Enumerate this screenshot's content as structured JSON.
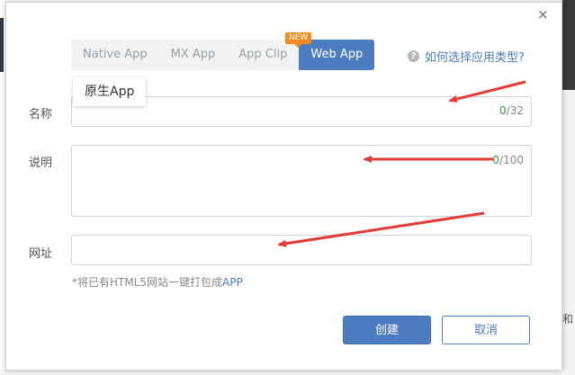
{
  "dialog": {
    "close_glyph": "×",
    "tabs": [
      {
        "label": "Native App",
        "active": false
      },
      {
        "label": "MX App",
        "active": false
      },
      {
        "label": "App Clip",
        "active": false
      },
      {
        "label": "Web App",
        "active": true
      }
    ],
    "new_badge": "NEW",
    "help_link": "如何选择应用类型?",
    "tooltip": "原生App",
    "fields": {
      "name": {
        "label": "名称",
        "value": "",
        "count": "0",
        "max": "/32"
      },
      "description": {
        "label": "说明",
        "value": "",
        "count": "0",
        "max": "/100"
      },
      "url": {
        "label": "网址",
        "value": ""
      }
    },
    "hint_prefix": "*将已有HTML5网站一键打包成",
    "hint_accent": "APP",
    "buttons": {
      "create": "创建",
      "cancel": "取消"
    }
  },
  "background": {
    "right_text": "和"
  },
  "colors": {
    "primary": "#4b7dc0",
    "badge": "#f08c1d",
    "counter_current": "#3c9a3c",
    "annotation_arrow": "#e53935"
  }
}
